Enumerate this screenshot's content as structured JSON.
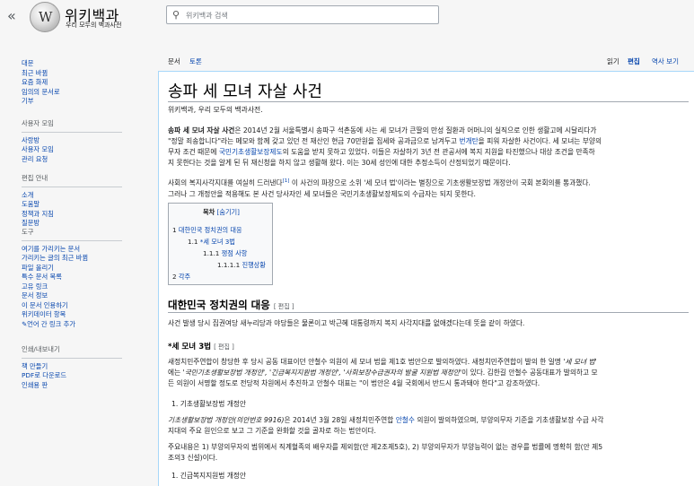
{
  "header": {
    "back_glyph": "«",
    "site_title": "위키백과",
    "site_tagline": "우리 모두의 백과사전",
    "search_placeholder": "위키백과 검색"
  },
  "sidebar": {
    "main": [
      "대문",
      "최근 바뀜",
      "요즘 화제",
      "임의의 문서로",
      "기부"
    ],
    "groups": [
      {
        "title": "사용자 모임",
        "items": [
          "사랑방",
          "사용자 모임",
          "관리 요청"
        ]
      },
      {
        "title": "편집 안내",
        "items": [
          "소개",
          "도움말",
          "정책과 지침",
          "질문방"
        ]
      },
      {
        "title": "도구",
        "items": [
          "여기를 가리키는 문서",
          "가리키는 글의 최근 바뀜",
          "파일 올리기",
          "특수 문서 목록",
          "고유 링크",
          "문서 정보",
          "이 문서 인용하기",
          "위키데이터 항목",
          "언어 간 링크 추가"
        ]
      },
      {
        "title": "인쇄/내보내기",
        "items": [
          "책 만들기",
          "PDF로 다운로드",
          "인쇄용 판"
        ]
      }
    ]
  },
  "tabs": {
    "left": [
      "문서",
      "토론"
    ],
    "right": [
      "읽기",
      "편집",
      "역사 보기"
    ]
  },
  "article": {
    "title": "송파 세 모녀 자살 사건",
    "site_sub": "위키백과, 우리 모두의 백과사전.",
    "p1": {
      "bold": "송파 세 모녀 자살 사건",
      "t1": "은 2014년 2월 서울특별시 송파구 석촌동에 사는 세 모녀가 큰딸의 만성 질환과 어머니의 실직으로 인한 생활고에 시달리다가",
      "t2": "\"정말 죄송합니다\"라는 메모와 함께 갖고 있던 전 재산인 현금 70만원을 집세와 공과금으로 남겨두고 ",
      "link1": "번개탄",
      "t3": "을 피워 자살한 사건이다. 세 모녀는 부양의",
      "t4": "무자 조건 때문에 ",
      "link2": "국민기초생활보장제도",
      "t5": "의 도움을 받지 못하고 있었다. 이들은 자살하기 3년 전 관공서에 복지 지원을 타진했으나 대상 조건을 만족하",
      "t6": "지 못한다는 것을 알게 된 뒤 재신청을 하지 않고 생활해 왔다. 이는 30세 성인에 대한 추정소득이 산정되었기 때문이다."
    },
    "p2": {
      "t1": "사회의 복지사각지대를 여실히 드러낸다",
      "ref": "[1]",
      "t2": " 이 사건의 파장으로 소위 '세 모녀 법'이라는 별칭으로 기초생활보장법 개정안이 국회 본회의를 통과했다.",
      "t3": "그러나 그 개정안을 적용해도 본 사건 당사자인 세 모녀들은 국민기초생활보장제도의 수급자는 되지 못한다."
    },
    "toc": {
      "title": "목차",
      "toggle": "[숨기기]",
      "items": [
        {
          "num": "1",
          "text": "대한민국 정치권의 대응"
        },
        {
          "num": "1.1",
          "text": "*세 모녀 3법"
        },
        {
          "num": "1.1.1",
          "text": "쟁점 사항"
        },
        {
          "num": "1.1.1.1",
          "text": "진행상황"
        },
        {
          "num": "2",
          "text": "각주"
        }
      ]
    },
    "sec1": {
      "heading": "대한민국 정치권의 대응",
      "edit": "[ 편집 ]",
      "p": "사건 발생 당시 집권여당 새누리당과 야당들은 물론이고 박근혜 대통령까지 복지 사각지대를 없애겠다는데 뜻을 같이 하였다."
    },
    "sub1": {
      "heading": "*세 모녀 3법",
      "edit": "[ 편집 ]",
      "p1": "새정치민주연합이 창당한 후 당시 공동 대표이던 안철수 의원이 세 모녀 법을 제1호 법안으로 발의하였다. 새정치민주연합이 발의 한 일명 ",
      "p1_ital": "'세 모녀 법'",
      "p2a": "에는 ",
      "p2_ital": "'국민기초생활보장법 개정안', '긴급복지지원법 개정안', '사회보장수급권자의 발굴 지원법 제정안'",
      "p2b": "이 있다. 김한길 안철수 공동대표가 발의하고 모",
      "p3": "든 의원이 서명할 정도로 전당적 차원에서 추진하고 안철수 대표는 \"이 법안은 4월 국회에서 반드시 통과돼야 한다\"고 강조하였다.",
      "list1": "1. 기초생활보장법 개정안",
      "q_ital": "기초생활보장법 개정안(의안번호 9916)",
      "q1": "은 2014년 3월 28일 새정치민주연합 ",
      "q_link": "안철수",
      "q2": " 의원이 발의하였으며, 부양의무자 기준을 기초생활보장 수급 사각",
      "q3": "지대의 주요 원인으로 보고 그 기준을 완화할 것을 골자로 하는 법안이다.",
      "m1": "주요내용은 1) 부양의무자의 범위에서 직계혈족의 배우자를 제외함(안 제2조제5호), 2) 부양의무자가 부양능력이 없는 경우를 법률에 명확히 함(안 제5",
      "m2": "조의3 신설)이다.",
      "list2": "1. 긴급복지지원법 개정안"
    }
  }
}
